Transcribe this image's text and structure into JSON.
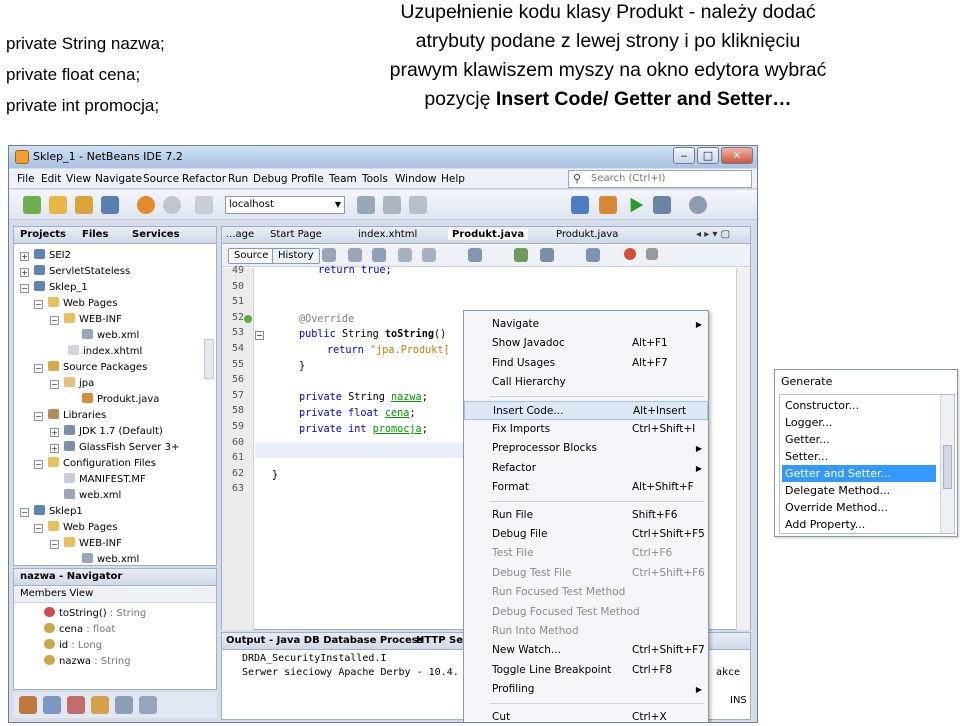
{
  "slide": {
    "left_code": [
      "private String nazwa;",
      "private float cena;",
      "private int promocja;"
    ],
    "title_lines": [
      "Uzupełnienie kodu klasy Produkt - należy dodać",
      "atrybuty podane z lewej strony i po kliknięciu",
      "prawym klawiszem myszy na okno edytora wybrać"
    ],
    "title_last_prefix": "pozycję ",
    "title_last_bold": "Insert Code/ Getter and Setter…"
  },
  "window": {
    "title": "Sklep_1 - NetBeans IDE 7.2",
    "buttons": [
      "‒",
      "□",
      "✕"
    ]
  },
  "menubar": [
    "File",
    "Edit",
    "View",
    "Navigate",
    "Source",
    "Refactor",
    "Run",
    "Debug",
    "Profile",
    "Team",
    "Tools",
    "Window",
    "Help"
  ],
  "search": {
    "placeholder": "Search (Ctrl+I)"
  },
  "toolbar": {
    "host": "localhost"
  },
  "projects": {
    "tabs": [
      "Projects",
      "Files",
      "Services"
    ],
    "tree": [
      {
        "label": "SEI2",
        "icon": "project-icon"
      },
      {
        "label": "ServletStateless",
        "icon": "project-icon"
      },
      {
        "label": "Sklep_1",
        "icon": "project-icon"
      },
      {
        "label": "Web Pages",
        "icon": "folder-icon"
      },
      {
        "label": "WEB-INF",
        "icon": "folder-icon"
      },
      {
        "label": "web.xml",
        "icon": "xml-file-icon"
      },
      {
        "label": "index.xhtml",
        "icon": "xhtml-file-icon"
      },
      {
        "label": "Source Packages",
        "icon": "package-folder-icon"
      },
      {
        "label": "jpa",
        "icon": "package-icon"
      },
      {
        "label": "Produkt.java",
        "icon": "java-file-icon"
      },
      {
        "label": "Libraries",
        "icon": "library-icon"
      },
      {
        "label": "JDK 1.7 (Default)",
        "icon": "jar-icon"
      },
      {
        "label": "GlassFish Server 3+",
        "icon": "jar-icon"
      },
      {
        "label": "Configuration Files",
        "icon": "folder-icon"
      },
      {
        "label": "MANIFEST.MF",
        "icon": "file-icon"
      },
      {
        "label": "web.xml",
        "icon": "xml-file-icon"
      },
      {
        "label": "Sklep1",
        "icon": "project-icon"
      },
      {
        "label": "Web Pages",
        "icon": "folder-icon"
      },
      {
        "label": "WEB-INF",
        "icon": "folder-icon"
      },
      {
        "label": "web.xml",
        "icon": "xml-file-icon"
      }
    ]
  },
  "navigator": {
    "title": "nazwa - Navigator",
    "view": "Members View",
    "items": [
      {
        "name": "toString()",
        "type": " : String"
      },
      {
        "name": "cena",
        "type": " : float"
      },
      {
        "name": "id",
        "type": " : Long"
      },
      {
        "name": "nazwa",
        "type": " : String"
      }
    ]
  },
  "editor": {
    "tabs": [
      "...age",
      "Start Page",
      "index.xhtml",
      "Produkt.java",
      "Produkt.java"
    ],
    "source_btn": "Source",
    "history_btn": "History",
    "line_numbers": [
      "49",
      "50",
      "51",
      "52",
      "53",
      "54",
      "55",
      "56",
      "57",
      "58",
      "59",
      "60",
      "61",
      "62",
      "63"
    ]
  },
  "output": {
    "tabs": [
      "Output - Java DB Database Process",
      "HTTP Serv"
    ],
    "lines": [
      "DRDA_SecurityInstalled.I",
      "Serwer sieciowy Apache Derby - 10.4.",
      "akce"
    ],
    "status": "INS"
  },
  "context_menu": {
    "groups": [
      [
        {
          "label": "Navigate",
          "shortcut": "",
          "submenu": true,
          "disabled": false
        },
        {
          "label": "Show Javadoc",
          "shortcut": "Alt+F1",
          "submenu": false,
          "disabled": false
        },
        {
          "label": "Find Usages",
          "shortcut": "Alt+F7",
          "submenu": false,
          "disabled": false
        },
        {
          "label": "Call Hierarchy",
          "shortcut": "",
          "submenu": false,
          "disabled": false
        }
      ],
      [
        {
          "label": "Insert Code...",
          "shortcut": "Alt+Insert",
          "submenu": false,
          "disabled": false,
          "selected": true
        },
        {
          "label": "Fix Imports",
          "shortcut": "Ctrl+Shift+I",
          "submenu": false,
          "disabled": false
        },
        {
          "label": "Preprocessor Blocks",
          "shortcut": "",
          "submenu": true,
          "disabled": false
        },
        {
          "label": "Refactor",
          "shortcut": "",
          "submenu": true,
          "disabled": false
        },
        {
          "label": "Format",
          "shortcut": "Alt+Shift+F",
          "submenu": false,
          "disabled": false
        }
      ],
      [
        {
          "label": "Run File",
          "shortcut": "Shift+F6",
          "submenu": false,
          "disabled": false
        },
        {
          "label": "Debug File",
          "shortcut": "Ctrl+Shift+F5",
          "submenu": false,
          "disabled": false
        },
        {
          "label": "Test File",
          "shortcut": "Ctrl+F6",
          "submenu": false,
          "disabled": true
        },
        {
          "label": "Debug Test File",
          "shortcut": "Ctrl+Shift+F6",
          "submenu": false,
          "disabled": true
        },
        {
          "label": "Run Focused Test Method",
          "shortcut": "",
          "submenu": false,
          "disabled": true
        },
        {
          "label": "Debug Focused Test Method",
          "shortcut": "",
          "submenu": false,
          "disabled": true
        },
        {
          "label": "Run Into Method",
          "shortcut": "",
          "submenu": false,
          "disabled": true
        },
        {
          "label": "New Watch...",
          "shortcut": "Ctrl+Shift+F7",
          "submenu": false,
          "disabled": false
        },
        {
          "label": "Toggle Line Breakpoint",
          "shortcut": "Ctrl+F8",
          "submenu": false,
          "disabled": false
        },
        {
          "label": "Profiling",
          "shortcut": "",
          "submenu": true,
          "disabled": false
        }
      ],
      [
        {
          "label": "Cut",
          "shortcut": "Ctrl+X",
          "submenu": false,
          "disabled": false
        }
      ]
    ]
  },
  "generate": {
    "title": "Generate",
    "items": [
      "Constructor...",
      "Logger...",
      "Getter...",
      "Setter...",
      "Getter and Setter...",
      "Delegate Method...",
      "Override Method...",
      "Add Property..."
    ],
    "selected_index": 4
  }
}
